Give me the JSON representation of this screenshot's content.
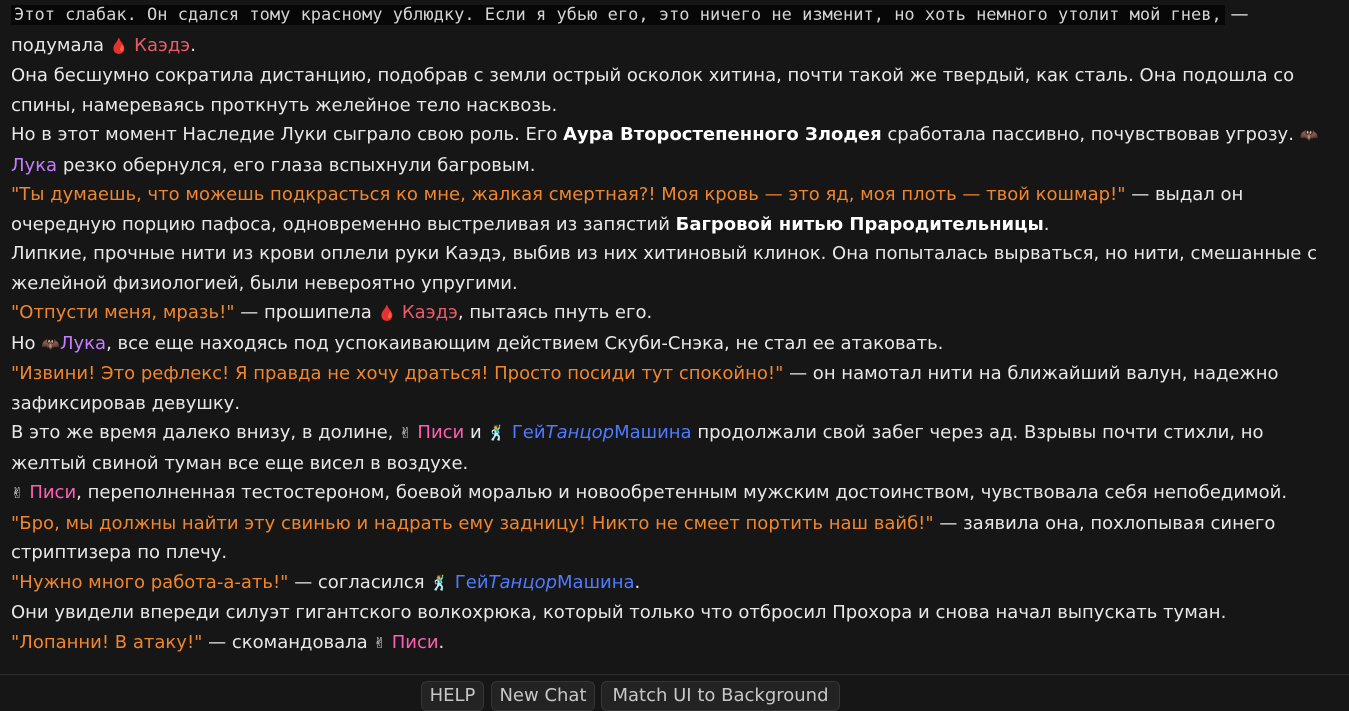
{
  "colors": {
    "background": "#161616",
    "quote": "#f0862e",
    "kaede": "#e85c6a",
    "luka": "#c77dff",
    "pisi": "#ff5fb3",
    "dancer": "#4e7bff"
  },
  "icons": {
    "kaede": "blood-drop",
    "luka": "bat",
    "pisi": "victory-hand",
    "dancer": "dancer"
  },
  "chars": {
    "kaede": "Каэдэ",
    "luka": "Лука",
    "pisi": "Писи",
    "dancer_a": "Гей",
    "dancer_b": "Танцор",
    "dancer_c": "Машина"
  },
  "messages": {
    "m0": {
      "code": "Этот слабак. Он сдался тому красному ублюдку. Если я убью его, это ничего не изменит, но хоть немного утолит мой гнев,",
      "b": " — подумала ",
      "c": "."
    },
    "m1": {
      "a": "Она бесшумно сократила дистанцию, подобрав с земли острый осколок хитина, почти такой же твердый, как сталь. Она подошла со спины, намереваясь проткнуть желейное тело насквозь."
    },
    "m2": {
      "a": "Но в этот момент Наследие Луки сыграло свою роль. Его ",
      "bold": "Аура Второстепенного Злодея",
      "b": " сработала пассивно, почувствовав угрозу. ",
      "c": " резко обернулся, его глаза вспыхнули багровым."
    },
    "m3": {
      "quote": "\"Ты думаешь, что можешь подкрасться ко мне, жалкая смертная?! Моя кровь — это яд, моя плоть — твой кошмар!\"",
      "b": " — выдал он очередную порцию пафоса, одновременно выстреливая из запястий ",
      "bold": "Багровой нитью Прародительницы",
      "c": "."
    },
    "m4": {
      "a": "Липкие, прочные нити из крови оплели руки Каэдэ, выбив из них хитиновый клинок. Она попыталась вырваться, но нити, смешанные с желейной физиологией, были невероятно упругими."
    },
    "m5": {
      "quote": "\"Отпусти меня, мразь!\"",
      "b": " — прошипела ",
      "c": ", пытаясь пнуть его."
    },
    "m6": {
      "a": "Но ",
      "b": ", все еще находясь под успокаивающим действием Скуби-Снэка, не стал ее атаковать."
    },
    "m7": {
      "quote": "\"Извини! Это рефлекс! Я правда не хочу драться! Просто посиди тут спокойно!\"",
      "b": " — он намотал нити на ближайший валун, надежно зафиксировав девушку."
    },
    "m8": {
      "a": "В это же время далеко внизу, в долине, ",
      "b": " и ",
      "c": " продолжали свой забег через ад. Взрывы почти стихли, но желтый свиной туман все еще висел в воздухе."
    },
    "m9": {
      "b": ", переполненная тестостероном, боевой моралью и новообретенным мужским достоинством, чувствовала себя непобедимой."
    },
    "m10": {
      "quote": "\"Бро, мы должны найти эту свинью и надрать ему задницу! Никто не смеет портить наш вайб!\"",
      "b": " — заявила она, похлопывая синего стриптизера по плечу."
    },
    "m11": {
      "quote": "\"Нужно многo работа-а-ать!\"",
      "b": " — согласился ",
      "c": "."
    },
    "m12": {
      "a": "Они увидели впереди силуэт гигантского волкохрюка, который только что отбросил Прохора и снова начал выпускать туман."
    },
    "m13": {
      "quote": "\"Лопанни! В атаку!\"",
      "b": " — скомандовала ",
      "c": "."
    }
  },
  "toolbar": {
    "help": "HELP",
    "new_chat": "New Chat",
    "match_ui": "Match UI to Background"
  }
}
